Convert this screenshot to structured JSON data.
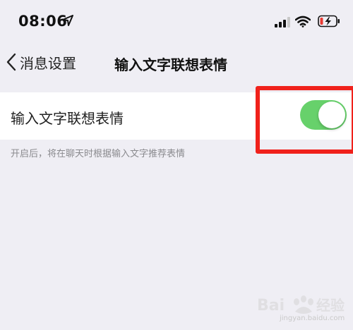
{
  "status_bar": {
    "time": "08:06",
    "icons": [
      "location-arrow-icon",
      "cellular-signal-icon",
      "wifi-icon",
      "battery-charging-icon"
    ]
  },
  "nav": {
    "back_label": "消息设置",
    "title": "输入文字联想表情"
  },
  "setting": {
    "label": "输入文字联想表情",
    "toggle_on": true,
    "footnote": "开启后，将在聊天时根据输入文字推荐表情"
  },
  "colors": {
    "toggle_on": "#67d16b",
    "highlight": "#f0211b",
    "background": "#efeef4",
    "battery_low": "#e83a32"
  },
  "watermark": {
    "brand": "Bai 经验",
    "url": "jingyan.baidu.com"
  }
}
